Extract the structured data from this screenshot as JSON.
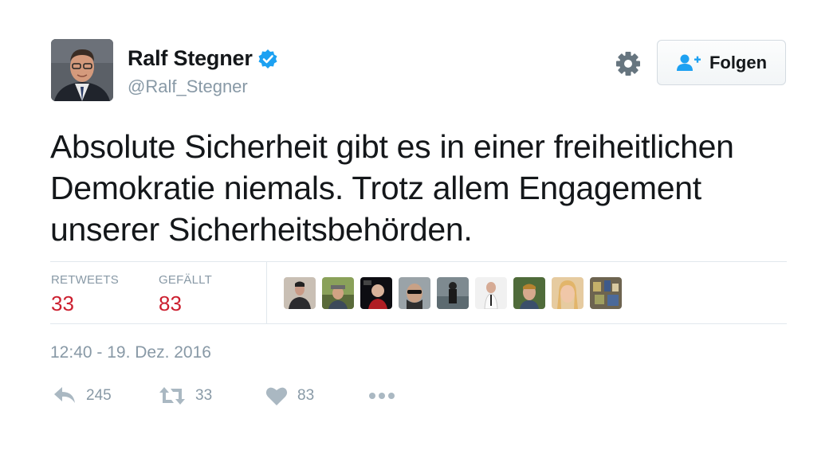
{
  "user": {
    "display_name": "Ralf Stegner",
    "handle": "@Ralf_Stegner"
  },
  "follow_button": {
    "label": "Folgen"
  },
  "tweet": {
    "text_lines": [
      "Absolute Sicherheit gibt es in einer freiheitlichen",
      "Demokratie niemals. Trotz allem Engagement",
      "unserer Sicherheitsbehörden."
    ],
    "timestamp": "12:40 - 19. Dez. 2016"
  },
  "stats": {
    "retweets_label": "RETWEETS",
    "retweets_value": "33",
    "likes_label": "GEFÄLLT",
    "likes_value": "83"
  },
  "actions": {
    "reply_count": "245",
    "retweet_count": "33",
    "like_count": "83"
  },
  "colors": {
    "verified": "#1da1f2",
    "stat_value": "#cc1f2f",
    "muted": "#8899a6",
    "divider": "#e1e8ed"
  },
  "icons": [
    "verified-badge-icon",
    "gear-icon",
    "follow-person-plus-icon",
    "reply-icon",
    "retweet-icon",
    "heart-icon",
    "more-dots-icon"
  ]
}
